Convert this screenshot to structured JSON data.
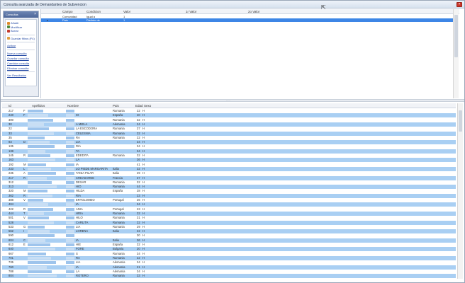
{
  "window": {
    "title": "Consulta avanzada de Demandantes de Subvencion",
    "close_glyph": "×"
  },
  "sidebar": {
    "header": "Consultas",
    "pin_glyph": "×",
    "items": [
      {
        "label": "Añadir",
        "color": "#e08a2a"
      },
      {
        "label": "Modificar",
        "color": "#4f8a3a"
      },
      {
        "label": "Borrar",
        "color": "#c33b2d"
      }
    ],
    "save_label": "Guardar filtros (F4)",
    "apply_label": "Aplicar",
    "links": [
      "Nueva consulta",
      "Guardar consulta",
      "Cambiar consulta",
      "Eliminar consulta"
    ],
    "results_label": "Ver Resultados"
  },
  "criteria": {
    "columns": [
      "Campo",
      "Condicion",
      "Valor",
      "1r Valor",
      "2o Valor"
    ],
    "rows": [
      {
        "campo": "Comunidad",
        "condicion": "Igual a",
        "valor": "1",
        "selected": false,
        "marker": ""
      },
      {
        "campo": "Pais",
        "condicion": "Distinto de",
        "valor": "1",
        "selected": true,
        "marker": "▸"
      }
    ]
  },
  "results": {
    "columns": [
      "Id",
      "Apellidos",
      "Nombre",
      "Pais",
      "Edad",
      "Sexo"
    ],
    "rows": [
      {
        "id": "217",
        "ap": "F",
        "nombre": "",
        "pais": "Rumania",
        "edad": "22",
        "sexo": "H"
      },
      {
        "id": "240",
        "ap": "F",
        "nombre": "IO",
        "pais": "España",
        "edad": "40",
        "sexo": "H"
      },
      {
        "id": "300",
        "ap": "",
        "nombre": "",
        "pais": "Rumania",
        "edad": "32",
        "sexo": "H"
      },
      {
        "id": "30",
        "ap": "",
        "nombre": "A MIELA",
        "pais": "Alemania",
        "edad": "24",
        "sexo": "H"
      },
      {
        "id": "22",
        "ap": "",
        "nombre": "LA ESCODORA",
        "pais": "Rumania",
        "edad": "37",
        "sexo": "H"
      },
      {
        "id": "33",
        "ap": "",
        "nombre": "CELESNIA",
        "pais": "Rumania",
        "edad": "32",
        "sexo": "H"
      },
      {
        "id": "35",
        "ap": "",
        "nombre": "RA",
        "pais": "Rumania",
        "edad": "22",
        "sexo": "H"
      },
      {
        "id": "93",
        "ap": "D",
        "nombre": "LIA",
        "pais": "",
        "edad": "34",
        "sexo": "H"
      },
      {
        "id": "135",
        "ap": "",
        "nombre": "RIA",
        "pais": "",
        "edad": "34",
        "sexo": "H"
      },
      {
        "id": "138",
        "ap": "",
        "nombre": "TA",
        "pais": "",
        "edad": "34",
        "sexo": "H"
      },
      {
        "id": "145",
        "ap": "R",
        "nombre": "EDEDITA",
        "pais": "Rumania",
        "edad": "32",
        "sexo": "H"
      },
      {
        "id": "163",
        "ap": "",
        "nombre": "LA",
        "pais": "",
        "edad": "26",
        "sexo": "H"
      },
      {
        "id": "192",
        "ap": "M",
        "nombre": "IA",
        "pais": "",
        "edad": "41",
        "sexo": "H"
      },
      {
        "id": "233",
        "ap": "L",
        "nombre": "LO PIEDE MARGARITA",
        "pais": "Italia",
        "edad": "32",
        "sexo": "H"
      },
      {
        "id": "235",
        "ap": "A",
        "nombre": "TANIA PILAR",
        "pais": "Italia",
        "edad": "29",
        "sexo": "H"
      },
      {
        "id": "217",
        "ap": "R",
        "nombre": "CREASARNE",
        "pais": "Francia",
        "edad": "37",
        "sexo": "H"
      },
      {
        "id": "312",
        "ap": "",
        "nombre": "DESAR",
        "pais": "Rumania",
        "edad": "32",
        "sexo": "H"
      },
      {
        "id": "313",
        "ap": "",
        "nombre": "HIO",
        "pais": "Rumania",
        "edad": "44",
        "sexo": "H"
      },
      {
        "id": "320",
        "ap": "M",
        "nombre": "HILDA",
        "pais": "España",
        "edad": "28",
        "sexo": "H"
      },
      {
        "id": "362",
        "ap": "R",
        "nombre": "RIA",
        "pais": "",
        "edad": "23",
        "sexo": "H"
      },
      {
        "id": "388",
        "ap": "V",
        "nombre": "ERTOLOMEO",
        "pais": "Portugal",
        "edad": "26",
        "sexo": "H"
      },
      {
        "id": "404",
        "ap": "",
        "nombre": "IA",
        "pais": "",
        "edad": "34",
        "sexo": "H"
      },
      {
        "id": "422",
        "ap": "R",
        "nombre": "ANIA",
        "pais": "Portugal",
        "edad": "23",
        "sexo": "H"
      },
      {
        "id": "444",
        "ap": "T",
        "nombre": "HRIA",
        "pais": "Rumania",
        "edad": "32",
        "sexo": "H"
      },
      {
        "id": "501",
        "ap": "V",
        "nombre": "HILO",
        "pais": "Rumania",
        "edad": "31",
        "sexo": "H"
      },
      {
        "id": "528",
        "ap": "",
        "nombre": "CARLITA",
        "pais": "Rumania",
        "edad": "32",
        "sexo": "H"
      },
      {
        "id": "533",
        "ap": "G",
        "nombre": "LIA",
        "pais": "Rumania",
        "edad": "29",
        "sexo": "H"
      },
      {
        "id": "562",
        "ap": "I",
        "nombre": "LORENA",
        "pais": "Italia",
        "edad": "22",
        "sexo": "H"
      },
      {
        "id": "590",
        "ap": "",
        "nombre": "",
        "pais": "",
        "edad": "30",
        "sexo": "H"
      },
      {
        "id": "604",
        "ap": "C",
        "nombre": "IA",
        "pais": "Italia",
        "edad": "36",
        "sexo": "H"
      },
      {
        "id": "612",
        "ap": "E",
        "nombre": "HIE",
        "pais": "España",
        "edad": "32",
        "sexo": "H"
      },
      {
        "id": "640",
        "ap": "",
        "nombre": "FORE",
        "pais": "Bulgaria",
        "edad": "20",
        "sexo": "H"
      },
      {
        "id": "667",
        "ap": "",
        "nombre": "S",
        "pais": "Rumania",
        "edad": "34",
        "sexo": "H"
      },
      {
        "id": "701",
        "ap": "",
        "nombre": "RA",
        "pais": "Rumania",
        "edad": "22",
        "sexo": "H"
      },
      {
        "id": "735",
        "ap": "",
        "nombre": "LIA",
        "pais": "Alemania",
        "edad": "34",
        "sexo": "H"
      },
      {
        "id": "760",
        "ap": "",
        "nombre": "IA",
        "pais": "Alemania",
        "edad": "21",
        "sexo": "H"
      },
      {
        "id": "788",
        "ap": "",
        "nombre": "LA",
        "pais": "Alemania",
        "edad": "34",
        "sexo": "H"
      },
      {
        "id": "804",
        "ap": "",
        "nombre": "ROTERO",
        "pais": "Rumania",
        "edad": "33",
        "sexo": "H"
      }
    ]
  },
  "colors": {
    "selected": "#3d86e6",
    "alt_row": "#a9cff3",
    "link": "#2147a3"
  }
}
